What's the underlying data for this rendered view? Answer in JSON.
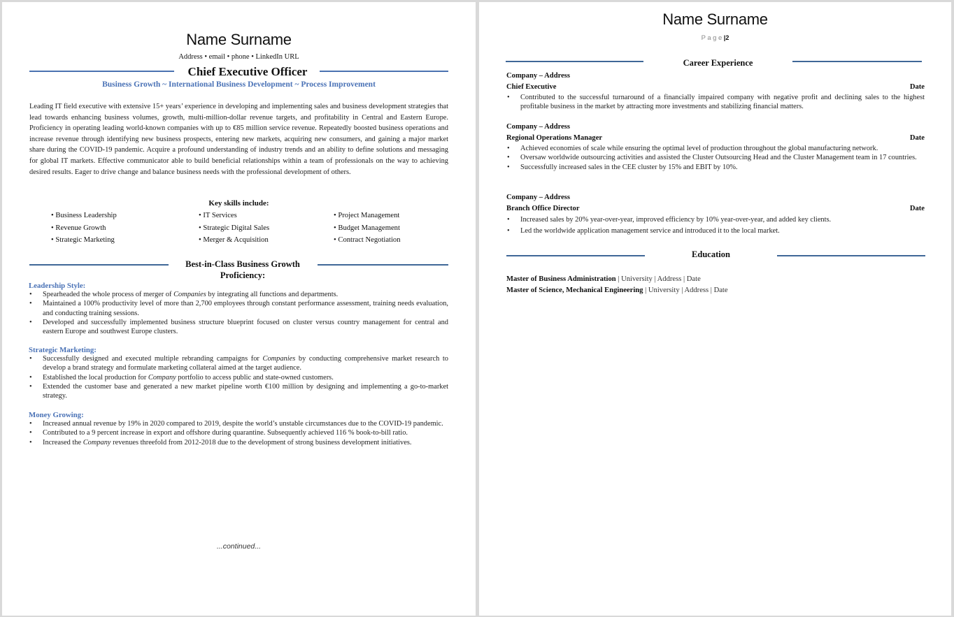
{
  "page1": {
    "name": "Name Surname",
    "contact": "Address • email • phone • LinkedIn URL",
    "headline": "Chief Executive Officer",
    "tagline": "Business Growth ~ International Business Development ~ Process Improvement",
    "summary": "Leading IT field executive with extensive 15+ years’ experience in developing and implementing sales and business development strategies that lead towards enhancing business volumes, growth, multi-million-dollar revenue targets, and profitability in Central and Eastern Europe. Proficiency in operating leading world-known companies with up to €85 million service revenue. Repeatedly boosted business operations and increase revenue through identifying new business prospects, entering new markets, acquiring new consumers, and gaining a major market share during the COVID-19 pandemic. Acquire a profound understanding of industry trends and an ability to define solutions and messaging for global IT markets.  Effective communicator able to build beneficial relationships within a team of professionals on the way to achieving desired results. Eager to drive change and balance business needs with the professional development of others.",
    "skills_title": "Key skills include:",
    "skills": [
      [
        "Business Leadership",
        "Revenue Growth",
        "Strategic Marketing"
      ],
      [
        "IT Services",
        "Strategic Digital Sales",
        "Merger & Acquisition"
      ],
      [
        "Project Management",
        "Budget Management",
        "Contract Negotiation"
      ]
    ],
    "skill_bullet": "•",
    "proficiency_title_line1": "Best-in-Class Business Growth",
    "proficiency_title_line2": "Proficiency:",
    "bullet": "•",
    "groups": [
      {
        "heading": "Leadership Style:",
        "items": [
          {
            "before": "Spearheaded the whole process of merger of ",
            "em": "Companies",
            "after": " by integrating all functions and departments."
          },
          {
            "before": "Maintained a 100% productivity level of more than 2,700 employees through constant performance assessment, training needs evaluation, and conducting training sessions.",
            "em": "",
            "after": ""
          },
          {
            "before": "Developed and successfully implemented business structure blueprint focused on cluster versus country management for central and eastern Europe and southwest Europe clusters.",
            "em": "",
            "after": ""
          }
        ]
      },
      {
        "heading": "Strategic Marketing:",
        "items": [
          {
            "before": "Successfully designed and executed multiple rebranding campaigns for ",
            "em": "Companies",
            "after": " by conducting comprehensive market research to develop a brand strategy and formulate marketing collateral aimed at the target audience."
          },
          {
            "before": "Established the local production for ",
            "em": "Company",
            "after": " portfolio to access public and state-owned customers."
          },
          {
            "before": "Extended the customer base and generated a new market pipeline worth €100 million by designing and implementing a go-to-market strategy.",
            "em": "",
            "after": ""
          }
        ]
      },
      {
        "heading": "Money Growing:",
        "items": [
          {
            "before": "Increased annual revenue by 19% in 2020 compared to 2019, despite the world’s unstable circumstances due to the COVID-19 pandemic.",
            "em": "",
            "after": ""
          },
          {
            "before": "Contributed to a 9 percent increase in export and offshore during quarantine. Subsequently achieved 116 % book-to-bill ratio.",
            "em": "",
            "after": ""
          },
          {
            "before": "Increased the ",
            "em": "Company",
            "after": " revenues threefold from 2012-2018 due to the development of strong business development initiatives."
          }
        ]
      }
    ],
    "continued": "...continued..."
  },
  "page2": {
    "name": "Name Surname",
    "page_word": "Page",
    "page_sep": "|",
    "page_number": "2",
    "career_title": "Career Experience",
    "bullet": "•",
    "jobs": [
      {
        "company": "Company – Address",
        "title": "Chief Executive",
        "date": "Date",
        "items": [
          "Contributed to the successful turnaround of a financially impaired company with negative profit and declining sales to the highest profitable business in the market by attracting more investments and stabilizing financial matters."
        ]
      },
      {
        "company": "Company – Address",
        "title": "Regional Operations Manager",
        "date": "Date",
        "items": [
          "Achieved economies of scale while ensuring the optimal level of production throughout the global manufacturing network.",
          "Oversaw worldwide outsourcing activities and assisted the Cluster Outsourcing Head and the Cluster Management team in 17 countries.",
          "Successfully increased sales in the CEE cluster by 15% and EBIT by 10%."
        ]
      },
      {
        "company": "Company – Address",
        "title": "Branch Office Director",
        "date": "Date",
        "items": [
          "Increased sales by 20% year-over-year, improved efficiency by 10% year-over-year, and added key clients.",
          "Led the worldwide application management service and introduced it to the local market."
        ]
      }
    ],
    "education_title": "Education",
    "education": [
      {
        "degree": "Master of Business Administration",
        "rest": " | University | Address | Date"
      },
      {
        "degree": "Master of Science, Mechanical Engineering",
        "rest": " | University | Address | Date"
      }
    ]
  }
}
